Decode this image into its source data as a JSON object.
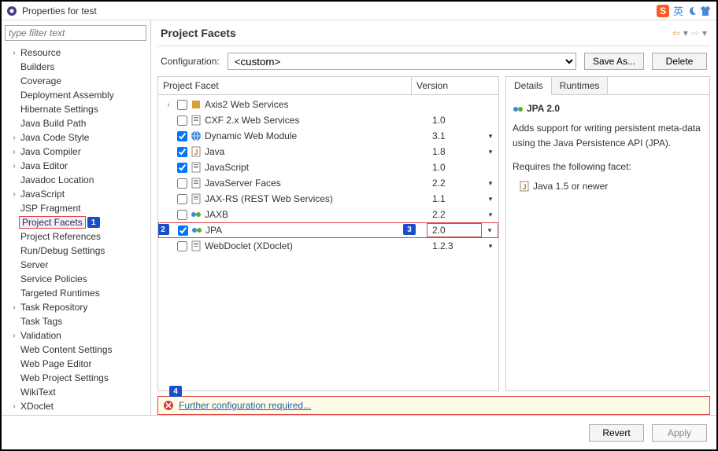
{
  "window": {
    "title": "Properties for test"
  },
  "filter": {
    "placeholder": "type filter text"
  },
  "sidebar": {
    "items": [
      {
        "label": "Resource",
        "expandable": true
      },
      {
        "label": "Builders"
      },
      {
        "label": "Coverage"
      },
      {
        "label": "Deployment Assembly"
      },
      {
        "label": "Hibernate Settings"
      },
      {
        "label": "Java Build Path"
      },
      {
        "label": "Java Code Style",
        "expandable": true
      },
      {
        "label": "Java Compiler",
        "expandable": true
      },
      {
        "label": "Java Editor",
        "expandable": true
      },
      {
        "label": "Javadoc Location"
      },
      {
        "label": "JavaScript",
        "expandable": true
      },
      {
        "label": "JSP Fragment"
      },
      {
        "label": "Project Facets",
        "selected": true,
        "callout": "1"
      },
      {
        "label": "Project References"
      },
      {
        "label": "Run/Debug Settings"
      },
      {
        "label": "Server"
      },
      {
        "label": "Service Policies"
      },
      {
        "label": "Targeted Runtimes"
      },
      {
        "label": "Task Repository",
        "expandable": true
      },
      {
        "label": "Task Tags"
      },
      {
        "label": "Validation",
        "expandable": true
      },
      {
        "label": "Web Content Settings"
      },
      {
        "label": "Web Page Editor"
      },
      {
        "label": "Web Project Settings"
      },
      {
        "label": "WikiText"
      },
      {
        "label": "XDoclet",
        "expandable": true
      }
    ]
  },
  "page": {
    "title": "Project Facets"
  },
  "config": {
    "label": "Configuration:",
    "value": "<custom>",
    "save": "Save As...",
    "delete": "Delete"
  },
  "facets": {
    "header_facet": "Project Facet",
    "header_version": "Version",
    "rows": [
      {
        "name": "Axis2 Web Services",
        "ver": "",
        "checked": false,
        "expandable": true,
        "icon": "axis"
      },
      {
        "name": "CXF 2.x Web Services",
        "ver": "1.0",
        "checked": false,
        "icon": "doc"
      },
      {
        "name": "Dynamic Web Module",
        "ver": "3.1",
        "dd": true,
        "checked": true,
        "icon": "web"
      },
      {
        "name": "Java",
        "ver": "1.8",
        "dd": true,
        "checked": true,
        "icon": "java"
      },
      {
        "name": "JavaScript",
        "ver": "1.0",
        "checked": true,
        "icon": "doc"
      },
      {
        "name": "JavaServer Faces",
        "ver": "2.2",
        "dd": true,
        "checked": false,
        "icon": "doc"
      },
      {
        "name": "JAX-RS (REST Web Services)",
        "ver": "1.1",
        "dd": true,
        "checked": false,
        "icon": "doc"
      },
      {
        "name": "JAXB",
        "ver": "2.2",
        "dd": true,
        "checked": false,
        "icon": "jaxb"
      },
      {
        "name": "JPA",
        "ver": "2.0",
        "dd": true,
        "checked": true,
        "icon": "jpa",
        "hl": true,
        "callout_left": "2",
        "callout_ver": "3"
      },
      {
        "name": "WebDoclet (XDoclet)",
        "ver": "1.2.3",
        "dd": true,
        "checked": false,
        "icon": "doc"
      }
    ]
  },
  "details": {
    "tabs": [
      "Details",
      "Runtimes"
    ],
    "active_tab": 0,
    "title": "JPA 2.0",
    "desc": "Adds support for writing persistent meta-data using the Java Persistence API (JPA).",
    "req_label": "Requires the following facet:",
    "req_item": "Java 1.5 or newer"
  },
  "warn": {
    "text": "Further configuration required...",
    "callout": "4"
  },
  "footer": {
    "revert": "Revert",
    "apply": "Apply"
  },
  "ime": {
    "label": "英"
  }
}
